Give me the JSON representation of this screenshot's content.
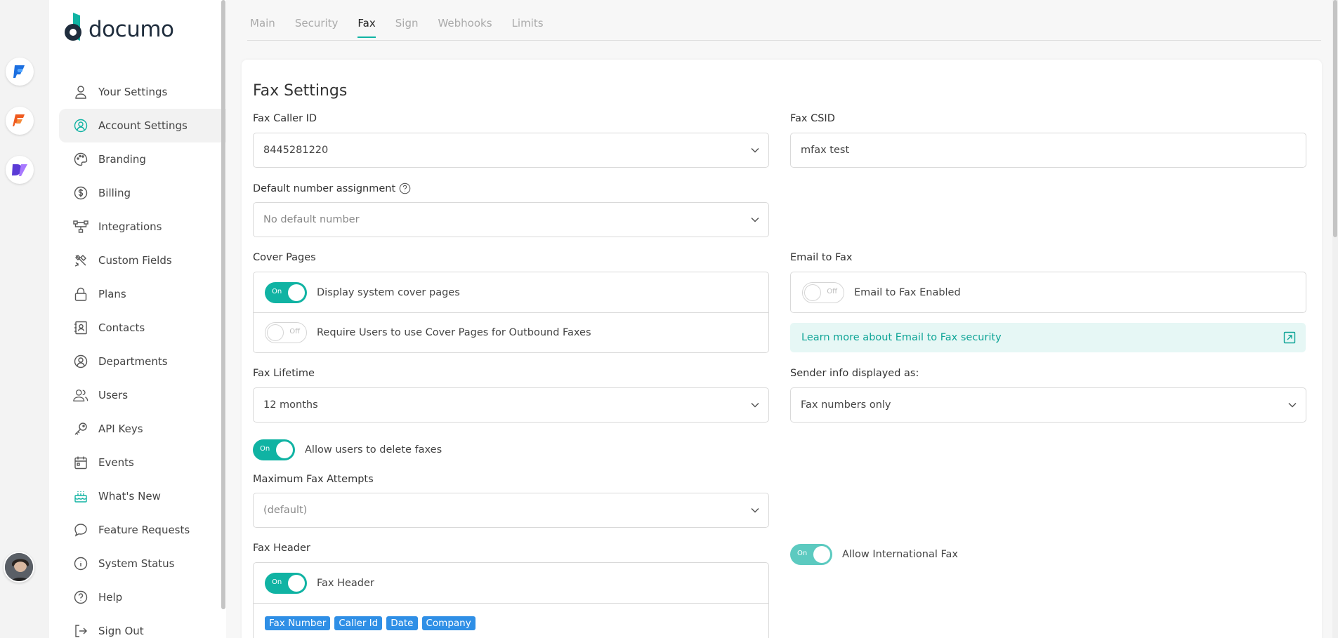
{
  "brand": {
    "name": "documo",
    "accent": "#10b3a3"
  },
  "rail": {
    "apps": [
      {
        "icon": "fax-app-icon"
      },
      {
        "icon": "sign-app-icon"
      },
      {
        "icon": "docs-app-icon"
      }
    ]
  },
  "sidebar": {
    "items": [
      {
        "label": "Your Settings",
        "icon": "user-icon"
      },
      {
        "label": "Account Settings",
        "icon": "account-icon",
        "active": true
      },
      {
        "label": "Branding",
        "icon": "palette-icon"
      },
      {
        "label": "Billing",
        "icon": "dollar-icon"
      },
      {
        "label": "Integrations",
        "icon": "integrations-icon"
      },
      {
        "label": "Custom Fields",
        "icon": "tools-icon"
      },
      {
        "label": "Plans",
        "icon": "lock-icon"
      },
      {
        "label": "Contacts",
        "icon": "contacts-icon"
      },
      {
        "label": "Departments",
        "icon": "departments-icon"
      },
      {
        "label": "Users",
        "icon": "users-icon"
      },
      {
        "label": "API Keys",
        "icon": "key-icon"
      },
      {
        "label": "Events",
        "icon": "calendar-icon"
      },
      {
        "label": "What's New",
        "icon": "cake-icon"
      },
      {
        "label": "Feature Requests",
        "icon": "chat-icon"
      },
      {
        "label": "System Status",
        "icon": "info-icon"
      },
      {
        "label": "Help",
        "icon": "help-icon"
      },
      {
        "label": "Sign Out",
        "icon": "sign-out-icon"
      }
    ]
  },
  "tabs": [
    {
      "label": "Main"
    },
    {
      "label": "Security"
    },
    {
      "label": "Fax",
      "active": true
    },
    {
      "label": "Sign"
    },
    {
      "label": "Webhooks"
    },
    {
      "label": "Limits"
    }
  ],
  "fax_settings": {
    "title": "Fax Settings",
    "caller_id": {
      "label": "Fax Caller ID",
      "value": "8445281220"
    },
    "csid": {
      "label": "Fax CSID",
      "value": "mfax test"
    },
    "default_number": {
      "label": "Default number assignment",
      "value": "No default number"
    },
    "cover_pages": {
      "label": "Cover Pages",
      "display_system": {
        "label": "Display system cover pages",
        "state": "On"
      },
      "require_users": {
        "label": "Require Users to use Cover Pages for Outbound Faxes",
        "state": "Off"
      }
    },
    "email_to_fax": {
      "label": "Email to Fax",
      "enabled": {
        "label": "Email to Fax Enabled",
        "state": "Off"
      },
      "learn_more": "Learn more about Email to Fax security"
    },
    "lifetime": {
      "label": "Fax Lifetime",
      "value": "12 months"
    },
    "sender_info": {
      "label": "Sender info displayed as:",
      "value": "Fax numbers only"
    },
    "allow_delete": {
      "label": "Allow users to delete faxes",
      "state": "On"
    },
    "max_attempts": {
      "label": "Maximum Fax Attempts",
      "value": "(default)"
    },
    "header": {
      "label": "Fax Header",
      "toggle": {
        "label": "Fax Header",
        "state": "On"
      },
      "chips": [
        "Fax Number",
        "Caller Id",
        "Date",
        "Company"
      ]
    },
    "international": {
      "label": "Allow International Fax",
      "state": "On"
    }
  }
}
